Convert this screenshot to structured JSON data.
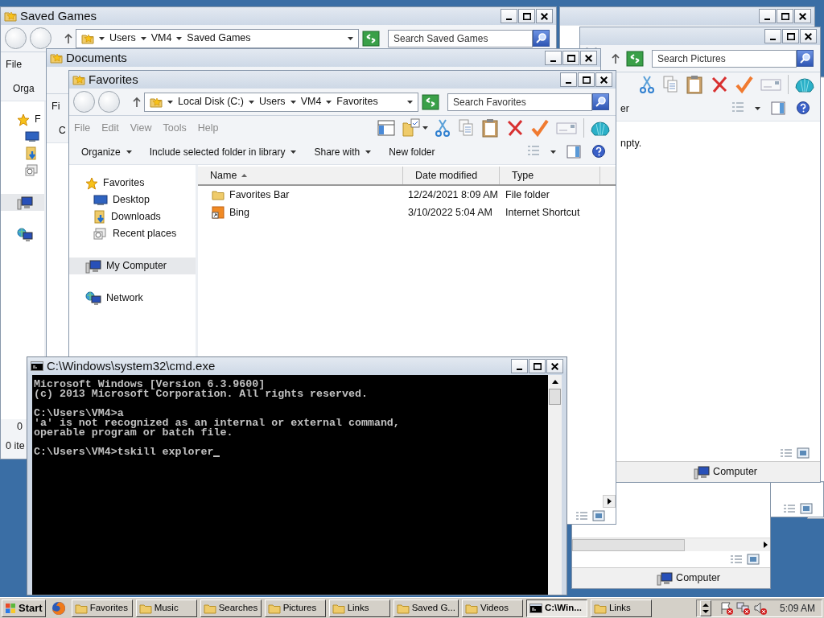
{
  "windows": [
    {
      "kind": "frame"
    },
    {
      "kind": "frame"
    },
    {
      "kind": "frame"
    },
    {
      "kind": "frame",
      "status": "Computer"
    },
    {
      "kind": "explorer",
      "search_placeholder": "Search Pictures",
      "commands": [
        {
          "label": "er",
          "dropdown": false
        }
      ],
      "empty_text": "npty.",
      "status": "Computer"
    },
    {
      "kind": "explorer",
      "title": "Saved Games",
      "address": [
        "Users",
        "VM4",
        "Saved Games"
      ],
      "search_placeholder": "Search Saved Games",
      "menu": [
        {
          "label": "File",
          "disabled": false
        }
      ],
      "commands": [
        {
          "label": "Orga",
          "dropdown": false
        }
      ],
      "nav": [
        {
          "kind": "favorites",
          "label": "F",
          "selected": false
        },
        {
          "kind": "desktop",
          "selected": false
        },
        {
          "kind": "downloads",
          "selected": false
        },
        {
          "kind": "recent",
          "selected": false
        },
        {
          "kind": "computer",
          "selected": true
        },
        {
          "kind": "network",
          "selected": false
        }
      ],
      "status_lines": [
        "0",
        "0 ite"
      ]
    },
    {
      "kind": "explorer",
      "title": "Documents",
      "menu": [
        {
          "label": "Fi",
          "disabled": false
        }
      ],
      "commands": [
        {
          "label": "C",
          "dropdown": false
        }
      ]
    },
    {
      "kind": "explorer",
      "title": "Favorites",
      "address": [
        "Local Disk (C:)",
        "Users",
        "VM4",
        "Favorites"
      ],
      "search_placeholder": "Search Favorites",
      "menu": [
        {
          "label": "File",
          "disabled": true
        },
        {
          "label": "Edit",
          "disabled": true
        },
        {
          "label": "View",
          "disabled": true
        },
        {
          "label": "Tools",
          "disabled": true
        },
        {
          "label": "Help",
          "disabled": true
        }
      ],
      "commands": [
        {
          "label": "Organize",
          "dropdown": true
        },
        {
          "label": "Include selected folder in library",
          "dropdown": true
        },
        {
          "label": "Share with",
          "dropdown": true
        },
        {
          "label": "New folder",
          "dropdown": false
        }
      ],
      "nav": [
        {
          "kind": "favorites",
          "label": "Favorites",
          "selected": false
        },
        {
          "kind": "desktop",
          "label": "Desktop",
          "selected": false
        },
        {
          "kind": "downloads",
          "label": "Downloads",
          "selected": false
        },
        {
          "kind": "recent",
          "label": "Recent places",
          "selected": false
        },
        {
          "kind": "computer",
          "label": "My Computer",
          "selected": true
        },
        {
          "kind": "network",
          "label": "Network",
          "selected": false
        }
      ],
      "columns": [
        {
          "label": "Name",
          "sorted": true
        },
        {
          "label": "Date modified",
          "sorted": false
        },
        {
          "label": "Type",
          "sorted": false
        }
      ],
      "rows": [
        {
          "kind": "folder",
          "name": "Favorites Bar",
          "date": "12/24/2021 8:09 AM",
          "type": "File folder"
        },
        {
          "kind": "shortcut",
          "name": "Bing",
          "date": "3/10/2022 5:04 AM",
          "type": "Internet Shortcut"
        }
      ]
    },
    {
      "kind": "console",
      "title": "C:\\Windows\\system32\\cmd.exe",
      "blocks": [
        [
          "Microsoft Windows [Version 6.3.9600]",
          "(c) 2013 Microsoft Corporation. All rights reserved."
        ],
        [
          "C:\\Users\\VM4>a",
          "'a' is not recognized as an internal or external command,",
          "operable program or batch file."
        ],
        [
          "C:\\Users\\VM4>tskill explorer"
        ]
      ]
    }
  ],
  "taskbar": {
    "start": "Start",
    "items": [
      {
        "kind": "folder",
        "label": "Favorites",
        "selected": false
      },
      {
        "kind": "folder",
        "label": "Music",
        "selected": false
      },
      {
        "kind": "folder",
        "label": "Searches",
        "selected": false
      },
      {
        "kind": "folder",
        "label": "Pictures",
        "selected": false
      },
      {
        "kind": "folder",
        "label": "Links",
        "selected": false
      },
      {
        "kind": "folder",
        "label": "Saved G...",
        "selected": false
      },
      {
        "kind": "folder",
        "label": "Videos",
        "selected": false
      },
      {
        "kind": "console",
        "label": "C:\\Win...",
        "selected": true
      },
      {
        "kind": "folder",
        "label": "Links",
        "selected": false
      }
    ],
    "clock": "5:09 AM"
  }
}
